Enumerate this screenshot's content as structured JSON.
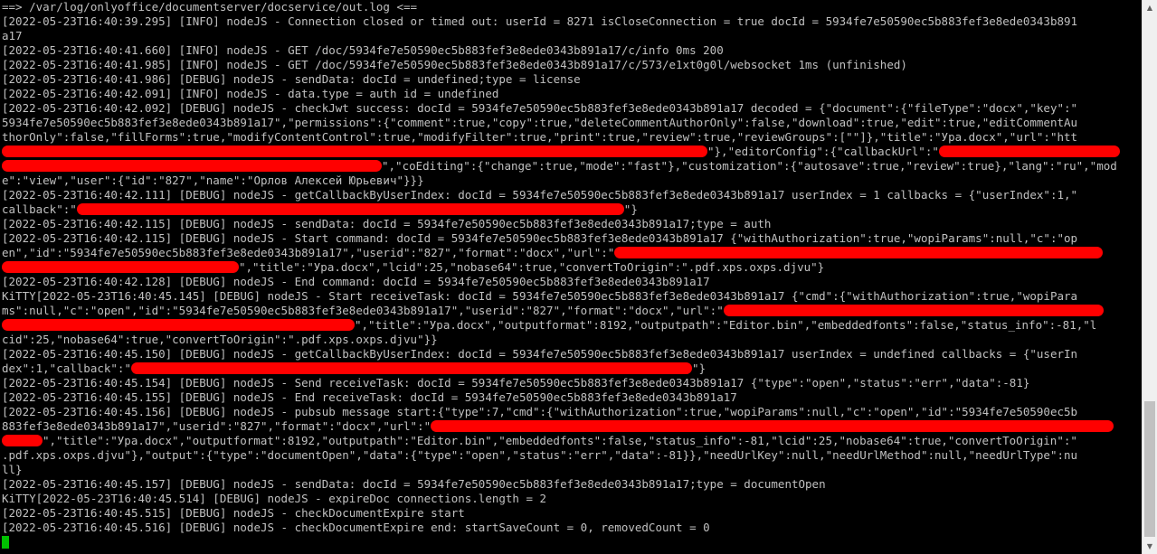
{
  "terminal": {
    "l01": "==> /var/log/onlyoffice/documentserver/docservice/out.log <==",
    "l02": "[2022-05-23T16:40:39.295] [INFO] nodeJS - Connection closed or timed out: userId = 8271 isCloseConnection = true docId = 5934fe7e50590ec5b883fef3e8ede0343b891",
    "l03": "a17",
    "l04": "[2022-05-23T16:40:41.660] [INFO] nodeJS - GET /doc/5934fe7e50590ec5b883fef3e8ede0343b891a17/c/info 0ms 200",
    "l05": "[2022-05-23T16:40:41.985] [INFO] nodeJS - GET /doc/5934fe7e50590ec5b883fef3e8ede0343b891a17/c/573/e1xt0g0l/websocket 1ms (unfinished)",
    "l06": "[2022-05-23T16:40:41.986] [DEBUG] nodeJS - sendData: docId = undefined;type = license",
    "l07": "[2022-05-23T16:40:42.091] [INFO] nodeJS - data.type = auth id = undefined",
    "l08": "[2022-05-23T16:40:42.092] [DEBUG] nodeJS - checkJwt success: docId = 5934fe7e50590ec5b883fef3e8ede0343b891a17 decoded = {\"document\":{\"fileType\":\"docx\",\"key\":\"",
    "l09": "5934fe7e50590ec5b883fef3e8ede0343b891a17\",\"permissions\":{\"comment\":true,\"copy\":true,\"deleteCommentAuthorOnly\":false,\"download\":true,\"edit\":true,\"editCommentAu",
    "l10": "thorOnly\":false,\"fillForms\":true,\"modifyContentControl\":true,\"modifyFilter\":true,\"print\":true,\"review\":true,\"reviewGroups\":[\"\"]},\"title\":\"Ура.docx\",\"url\":\"htt",
    "l11": "\"},\"editorConfig\":{\"callbackUrl\":\"",
    "l12": "\",\"coEditing\":{\"change\":true,\"mode\":\"fast\"},\"customization\":{\"autosave\":true,\"review\":true},\"lang\":\"ru\",\"mod",
    "l13": "e\":\"view\",\"user\":{\"id\":\"827\",\"name\":\"Орлов Алексей Юрьевич\"}}}",
    "l14": "[2022-05-23T16:40:42.111] [DEBUG] nodeJS - getCallbackByUserIndex: docId = 5934fe7e50590ec5b883fef3e8ede0343b891a17 userIndex = 1 callbacks = {\"userIndex\":1,\"",
    "l15a": "callback\":\"",
    "l15b": "\"}",
    "l16": "[2022-05-23T16:40:42.115] [DEBUG] nodeJS - sendData: docId = 5934fe7e50590ec5b883fef3e8ede0343b891a17;type = auth",
    "l17": "[2022-05-23T16:40:42.115] [DEBUG] nodeJS - Start command: docId = 5934fe7e50590ec5b883fef3e8ede0343b891a17 {\"withAuthorization\":true,\"wopiParams\":null,\"c\":\"op",
    "l18": "en\",\"id\":\"5934fe7e50590ec5b883fef3e8ede0343b891a17\",\"userid\":\"827\",\"format\":\"docx\",\"url\":\"",
    "l19": "\",\"title\":\"Ура.docx\",\"lcid\":25,\"nobase64\":true,\"convertToOrigin\":\".pdf.xps.oxps.djvu\"}",
    "l20": "[2022-05-23T16:40:42.128] [DEBUG] nodeJS - End command: docId = 5934fe7e50590ec5b883fef3e8ede0343b891a17",
    "l21": "KiTTY[2022-05-23T16:40:45.145] [DEBUG] nodeJS - Start receiveTask: docId = 5934fe7e50590ec5b883fef3e8ede0343b891a17 {\"cmd\":{\"withAuthorization\":true,\"wopiPara",
    "l22": "ms\":null,\"c\":\"open\",\"id\":\"5934fe7e50590ec5b883fef3e8ede0343b891a17\",\"userid\":\"827\",\"format\":\"docx\",\"url\":\"",
    "l23": "\",\"title\":\"Ура.docx\",\"outputformat\":8192,\"outputpath\":\"Editor.bin\",\"embeddedfonts\":false,\"status_info\":-81,\"l",
    "l24": "cid\":25,\"nobase64\":true,\"convertToOrigin\":\".pdf.xps.oxps.djvu\"}}",
    "l25": "[2022-05-23T16:40:45.150] [DEBUG] nodeJS - getCallbackByUserIndex: docId = 5934fe7e50590ec5b883fef3e8ede0343b891a17 userIndex = undefined callbacks = {\"userIn",
    "l26a": "dex\":1,\"callback\":\"",
    "l26b": "\"}",
    "l27": "[2022-05-23T16:40:45.154] [DEBUG] nodeJS - Send receiveTask: docId = 5934fe7e50590ec5b883fef3e8ede0343b891a17 {\"type\":\"open\",\"status\":\"err\",\"data\":-81}",
    "l28": "[2022-05-23T16:40:45.155] [DEBUG] nodeJS - End receiveTask: docId = 5934fe7e50590ec5b883fef3e8ede0343b891a17",
    "l29": "[2022-05-23T16:40:45.156] [DEBUG] nodeJS - pubsub message start:{\"type\":7,\"cmd\":{\"withAuthorization\":true,\"wopiParams\":null,\"c\":\"open\",\"id\":\"5934fe7e50590ec5b",
    "l30": "883fef3e8ede0343b891a17\",\"userid\":\"827\",\"format\":\"docx\",\"url\":\"",
    "l31": "\",\"title\":\"Ура.docx\",\"outputformat\":8192,\"outputpath\":\"Editor.bin\",\"embeddedfonts\":false,\"status_info\":-81,\"lcid\":25,\"nobase64\":true,\"convertToOrigin\":\"",
    "l32": ".pdf.xps.oxps.djvu\"},\"output\":{\"type\":\"documentOpen\",\"data\":{\"type\":\"open\",\"status\":\"err\",\"data\":-81}},\"needUrlKey\":null,\"needUrlMethod\":null,\"needUrlType\":nu",
    "l33": "ll}",
    "l34": "[2022-05-23T16:40:45.157] [DEBUG] nodeJS - sendData: docId = 5934fe7e50590ec5b883fef3e8ede0343b891a17;type = documentOpen",
    "l35": "KiTTY[2022-05-23T16:40:45.514] [DEBUG] nodeJS - expireDoc connections.length = 2",
    "l36": "[2022-05-23T16:40:45.515] [DEBUG] nodeJS - checkDocumentExpire start",
    "l37": "[2022-05-23T16:40:45.516] [DEBUG] nodeJS - checkDocumentExpire end: startSaveCount = 0, removedCount = 0"
  },
  "colors": {
    "background": "#000000",
    "text": "#c0c0c0",
    "redaction": "#ff0000",
    "cursor": "#00c000"
  },
  "icons": {
    "scroll_up": "arrow-up-icon",
    "scroll_down": "arrow-down-icon"
  }
}
